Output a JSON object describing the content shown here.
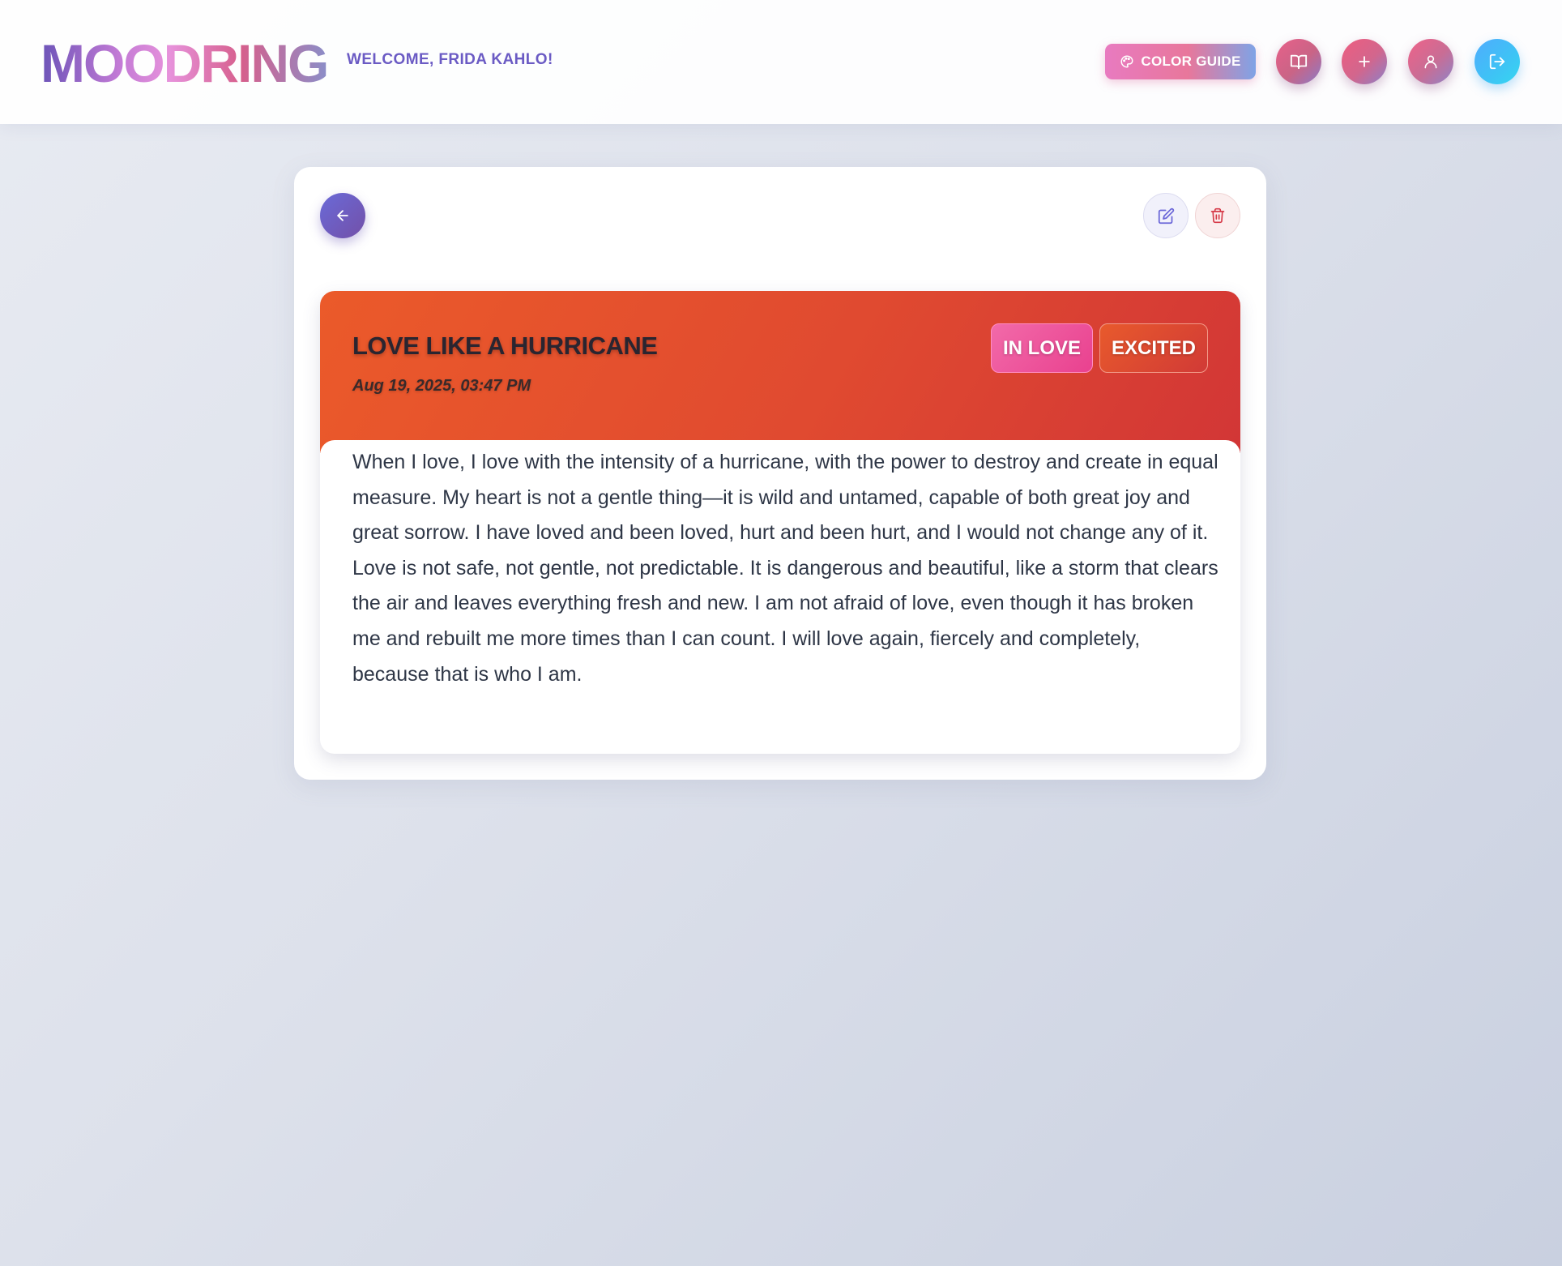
{
  "header": {
    "logo": "MOODRING",
    "welcome": "WELCOME, FRIDA KAHLO!",
    "color_guide_label": "COLOR GUIDE",
    "icons": {
      "color_guide": "palette-icon",
      "journal": "book-open-icon",
      "add": "plus-icon",
      "profile": "user-icon",
      "logout": "logout-icon"
    }
  },
  "entry_card": {
    "actions": {
      "back": "arrow-left-icon",
      "edit": "edit-icon",
      "delete": "trash-icon"
    },
    "title": "LOVE LIKE A HURRICANE",
    "date": "Aug 19, 2025, 03:47 PM",
    "tags": [
      "IN LOVE",
      "EXCITED"
    ],
    "body": "When I love, I love with the intensity of a hurricane, with the power to destroy and create in equal measure. My heart is not a gentle thing—it is wild and untamed, capable of both great joy and great sorrow. I have loved and been loved, hurt and been hurt, and I would not change any of it. Love is not safe, not gentle, not predictable. It is dangerous and beautiful, like a storm that clears the air and leaves everything fresh and new. I am not afraid of love, even though it has broken me and rebuilt me more times than I can count. I will love again, fiercely and completely, because that is who I am."
  },
  "colors": {
    "header_accent": "#6b5bc4",
    "entry_gradient_start": "#eb5a2a",
    "entry_gradient_end": "#d23636",
    "tag_in_love": "#e9418f",
    "tag_excited": "#d13a36"
  }
}
